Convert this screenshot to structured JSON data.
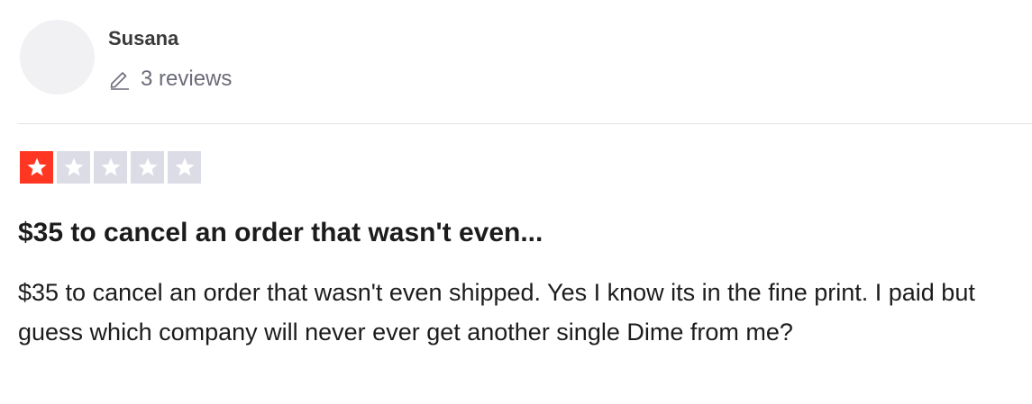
{
  "reviewer": {
    "name": "Susana",
    "review_count": "3 reviews",
    "review_count_icon": "pencil-icon"
  },
  "rating": {
    "value": 1,
    "max": 5,
    "filled_color": "#ff3722",
    "empty_color": "#dcdce6",
    "star_color": "#ffffff"
  },
  "review": {
    "title": "$35 to cancel an order that wasn't even...",
    "body": "$35 to cancel an order that wasn't even shipped. Yes I know its in the fine print. I paid but guess which company will never ever get another single Dime from me?"
  }
}
